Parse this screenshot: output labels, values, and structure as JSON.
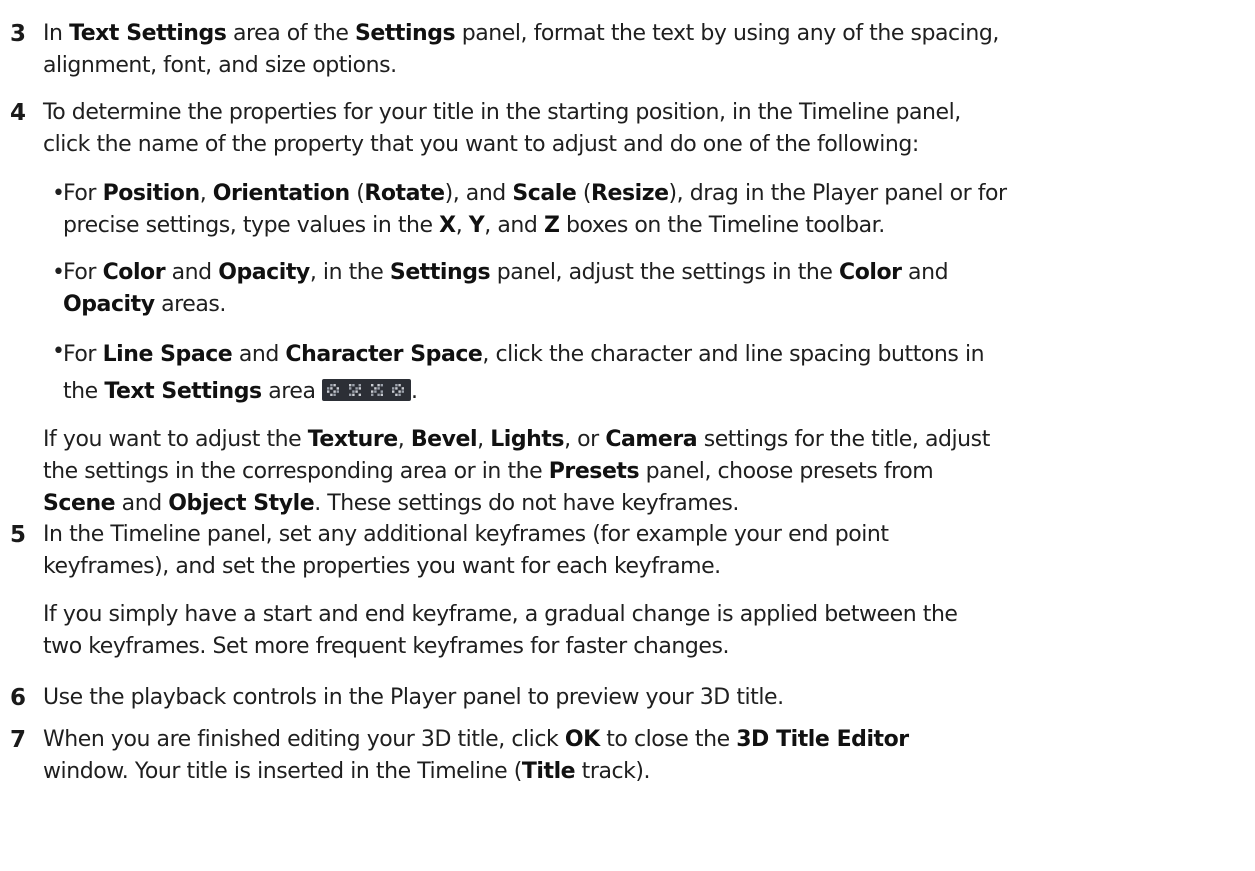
{
  "steps": [
    {
      "number": "3",
      "lines": [
        [
          "In ",
          {
            "b": "Text Settings"
          },
          " area of the ",
          {
            "b": "Settings"
          },
          " panel, format the text by using any of the spacing,"
        ],
        [
          "alignment, font, and size options."
        ]
      ]
    },
    {
      "number": "4",
      "lines": [
        [
          "To determine the properties for your title in the starting position, in the Timeline panel,"
        ],
        [
          "click the name of the property that you want to adjust and do one of the following:"
        ]
      ],
      "bullets": [
        {
          "lines": [
            [
              "For ",
              {
                "b": "Position"
              },
              ", ",
              {
                "b": "Orientation"
              },
              " (",
              {
                "b": "Rotate"
              },
              "), and ",
              {
                "b": "Scale"
              },
              " (",
              {
                "b": "Resize"
              },
              "), drag in the Player panel or for"
            ],
            [
              "precise settings, type values in the ",
              {
                "b": "X"
              },
              ", ",
              {
                "b": "Y"
              },
              ", and ",
              {
                "b": "Z"
              },
              " boxes on the Timeline toolbar."
            ]
          ]
        },
        {
          "lines": [
            [
              "For ",
              {
                "b": "Color"
              },
              " and ",
              {
                "b": "Opacity"
              },
              ", in the ",
              {
                "b": "Settings"
              },
              " panel, adjust the settings in the ",
              {
                "b": "Color"
              },
              " and"
            ],
            [
              {
                "b": "Opacity"
              },
              " areas."
            ]
          ]
        },
        {
          "lines": [
            [
              "For ",
              {
                "b": "Line Space"
              },
              " and ",
              {
                "b": "Character Space"
              },
              ", click the character and line spacing buttons in"
            ],
            [
              "the ",
              {
                "b": "Text Settings"
              },
              " area ",
              {
                "icon": "spacing-buttons-icon"
              },
              "."
            ]
          ]
        }
      ],
      "after": [
        [
          "If you want to adjust the ",
          {
            "b": "Texture"
          },
          ", ",
          {
            "b": "Bevel"
          },
          ", ",
          {
            "b": "Lights"
          },
          ", or ",
          {
            "b": "Camera"
          },
          " settings for the title, adjust"
        ],
        [
          "the settings in the corresponding area or in the ",
          {
            "b": "Presets"
          },
          " panel, choose presets from"
        ],
        [
          {
            "b": "Scene"
          },
          " and ",
          {
            "b": "Object Style"
          },
          ". These settings do not have keyframes."
        ]
      ]
    },
    {
      "number": "5",
      "lines": [
        [
          "In the Timeline panel, set any additional keyframes (for example your end point"
        ],
        [
          "keyframes), and set the properties you want for each keyframe."
        ]
      ],
      "after": [
        [
          "If you simply have a start and end keyframe, a gradual change is applied between the"
        ],
        [
          "two keyframes. Set more frequent keyframes for faster changes."
        ]
      ]
    },
    {
      "number": "6",
      "lines": [
        [
          "Use the playback controls in the Player panel to preview your 3D title."
        ]
      ]
    },
    {
      "number": "7",
      "lines": [
        [
          "When you are finished editing your 3D title, click ",
          {
            "b": "OK"
          },
          " to close the ",
          {
            "b": "3D Title Editor"
          }
        ],
        [
          "window. Your title is inserted in the Timeline (",
          {
            "b": "Title"
          },
          " track)."
        ]
      ]
    }
  ]
}
